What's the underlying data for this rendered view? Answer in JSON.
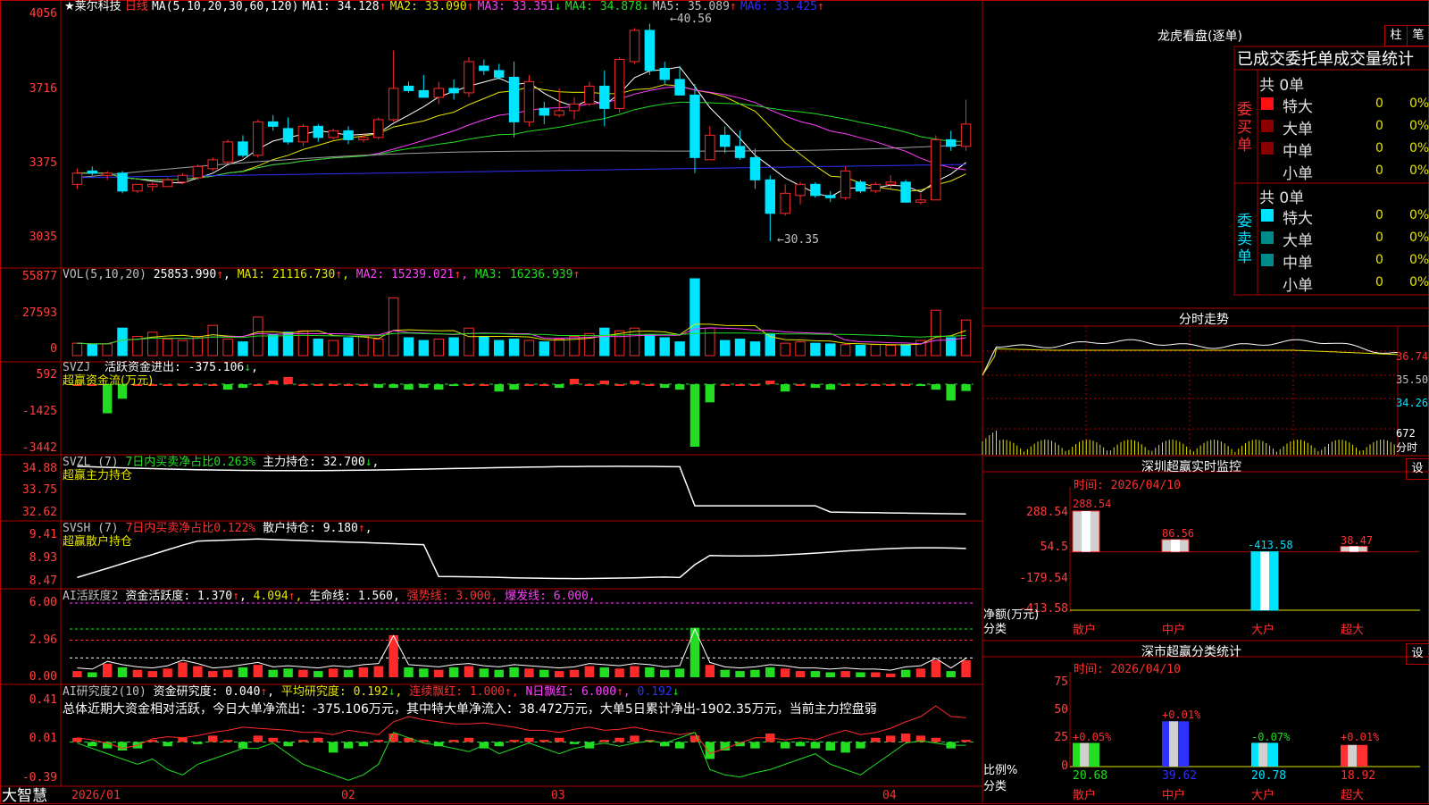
{
  "colors": {
    "up": "#ff2a2a",
    "down": "#00e5ff",
    "ma1": "#ffffff",
    "ma2": "#e6e600",
    "ma3": "#ff40ff",
    "ma4": "#22dd22",
    "ma5": "#a0a0a0",
    "ma6": "#3030ff",
    "frame": "#b00000"
  },
  "kline": {
    "name": "莱尔科技",
    "period": "日线",
    "ma_periods": "MA(5,10,20,30,60,120)",
    "ma1_label": "MA1:",
    "ma1_value": "34.128",
    "ma1_arrow": "↑",
    "ma2_label": "MA2:",
    "ma2_value": "33.090",
    "ma2_arrow": "↑",
    "ma3_label": "MA3:",
    "ma3_value": "33.351",
    "ma3_arrow": "↓",
    "ma4_label": "MA4:",
    "ma4_value": "34.878",
    "ma4_arrow": "↓",
    "ma5_label": "MA5:",
    "ma5_value": "35.089",
    "ma5_arrow": "↑",
    "ma6_label": "MA6:",
    "ma6_value": "33.425",
    "ma6_arrow": "↑",
    "y_ticks": [
      "4056",
      "3716",
      "3375",
      "3035"
    ],
    "high_marker": "40.56",
    "low_marker": "30.35",
    "candles": [
      [
        32.9,
        33.6,
        32.7,
        33.4
      ],
      [
        33.5,
        33.7,
        33.3,
        33.4
      ],
      [
        33.3,
        33.5,
        33.1,
        33.4
      ],
      [
        33.4,
        33.5,
        32.5,
        32.6
      ],
      [
        32.6,
        32.9,
        32.5,
        32.9
      ],
      [
        32.8,
        33.0,
        32.6,
        32.9
      ],
      [
        32.8,
        33.2,
        32.8,
        33.1
      ],
      [
        33.0,
        33.4,
        32.9,
        33.3
      ],
      [
        33.2,
        33.8,
        33.1,
        33.7
      ],
      [
        33.6,
        34.1,
        33.5,
        34.0
      ],
      [
        33.9,
        34.9,
        33.8,
        34.8
      ],
      [
        34.8,
        35.1,
        34.1,
        34.2
      ],
      [
        34.2,
        35.8,
        34.1,
        35.7
      ],
      [
        35.7,
        36.0,
        35.3,
        35.5
      ],
      [
        35.4,
        35.9,
        34.7,
        34.8
      ],
      [
        34.8,
        35.6,
        34.6,
        35.5
      ],
      [
        35.5,
        35.6,
        34.8,
        35.0
      ],
      [
        35.0,
        35.4,
        34.9,
        35.3
      ],
      [
        35.3,
        35.5,
        34.7,
        34.9
      ],
      [
        34.9,
        35.2,
        34.8,
        35.0
      ],
      [
        35.0,
        35.9,
        34.9,
        35.8
      ],
      [
        35.8,
        38.9,
        35.7,
        37.2
      ],
      [
        37.3,
        37.5,
        37.0,
        37.1
      ],
      [
        37.1,
        37.8,
        36.8,
        36.8
      ],
      [
        36.8,
        37.5,
        36.5,
        37.2
      ],
      [
        37.2,
        37.6,
        36.7,
        37.0
      ],
      [
        37.0,
        38.6,
        36.8,
        38.4
      ],
      [
        38.2,
        38.5,
        37.8,
        38.0
      ],
      [
        38.0,
        38.3,
        37.6,
        37.7
      ],
      [
        37.7,
        38.4,
        35.0,
        35.7
      ],
      [
        35.7,
        37.8,
        35.5,
        37.5
      ],
      [
        36.3,
        36.6,
        35.6,
        36.0
      ],
      [
        36.0,
        37.2,
        35.9,
        36.2
      ],
      [
        36.2,
        36.8,
        35.8,
        36.5
      ],
      [
        36.5,
        37.5,
        36.4,
        37.3
      ],
      [
        37.3,
        38.0,
        35.5,
        36.3
      ],
      [
        36.3,
        38.6,
        36.1,
        38.5
      ],
      [
        38.4,
        39.9,
        38.3,
        39.8
      ],
      [
        39.8,
        40.1,
        37.8,
        38.0
      ],
      [
        38.1,
        38.4,
        37.4,
        37.6
      ],
      [
        37.6,
        38.2,
        37.0,
        36.9
      ],
      [
        36.9,
        37.4,
        33.4,
        34.1
      ],
      [
        34.0,
        35.5,
        34.0,
        35.1
      ],
      [
        35.1,
        35.5,
        34.3,
        34.6
      ],
      [
        34.6,
        35.3,
        34.0,
        34.1
      ],
      [
        34.1,
        34.5,
        32.7,
        33.1
      ],
      [
        33.1,
        33.3,
        30.35,
        31.6
      ],
      [
        31.6,
        32.9,
        31.5,
        32.5
      ],
      [
        32.4,
        33.0,
        32.0,
        32.9
      ],
      [
        32.9,
        33.0,
        32.3,
        32.4
      ],
      [
        32.4,
        32.6,
        32.1,
        32.3
      ],
      [
        32.3,
        33.7,
        32.2,
        33.5
      ],
      [
        33.0,
        33.1,
        32.5,
        32.6
      ],
      [
        32.6,
        33.0,
        32.5,
        32.9
      ],
      [
        32.9,
        33.3,
        32.7,
        33.0
      ],
      [
        33.0,
        33.1,
        32.1,
        32.1
      ],
      [
        32.1,
        32.5,
        32.0,
        32.2
      ],
      [
        32.2,
        35.1,
        32.2,
        34.9
      ],
      [
        34.9,
        35.3,
        34.4,
        34.6
      ],
      [
        34.6,
        36.7,
        34.4,
        35.6
      ]
    ]
  },
  "volume": {
    "label": "VOL(5,10,20)",
    "value": "25853.990",
    "arrow": "↑",
    "ma1_label": "MA1:",
    "ma1_value": "21116.730",
    "ma1_arrow": "↑",
    "ma2_label": "MA2:",
    "ma2_value": "15239.021",
    "ma2_arrow": "↑",
    "ma3_label": "MA3:",
    "ma3_value": "16236.939",
    "ma3_arrow": "↑",
    "y_ticks": [
      "55877",
      "27593",
      "0"
    ],
    "values": [
      9000,
      8000,
      8500,
      20000,
      14000,
      17000,
      12000,
      11000,
      14000,
      22000,
      12000,
      10000,
      28000,
      15000,
      17000,
      18000,
      12000,
      11000,
      13000,
      14000,
      12000,
      42000,
      13000,
      11000,
      12000,
      13000,
      20000,
      14000,
      11000,
      12000,
      11000,
      10000,
      12000,
      14000,
      16000,
      20000,
      18000,
      20000,
      15000,
      13000,
      10000,
      55877,
      20000,
      11000,
      12000,
      10000,
      16000,
      9000,
      10000,
      9000,
      8500,
      8000,
      7500,
      8000,
      7500,
      8000,
      11000,
      33000,
      13000,
      25853
    ]
  },
  "svzj": {
    "label": "SVZJ",
    "name": "活跃资金进出:",
    "value": "-375.106",
    "arrow": "↓",
    "sub": "超赢资金流(万元)",
    "y_ticks": [
      "592",
      "-1425",
      "-3442"
    ],
    "values": [
      0,
      0,
      -1600,
      -800,
      0,
      0,
      0,
      0,
      0,
      0,
      -300,
      -200,
      0,
      200,
      400,
      0,
      0,
      0,
      0,
      0,
      -200,
      -200,
      -300,
      -200,
      -300,
      -100,
      0,
      0,
      -400,
      -300,
      0,
      0,
      -200,
      300,
      0,
      200,
      0,
      200,
      0,
      -200,
      -300,
      -3442,
      -1000,
      0,
      0,
      0,
      200,
      -400,
      0,
      -200,
      -300,
      0,
      0,
      0,
      0,
      0,
      -100,
      -300,
      -900,
      -375
    ]
  },
  "svzl": {
    "label": "SVZL (7)",
    "sub_label": "7日内买卖净占比",
    "sub_value": "0.263%",
    "name": "主力持仓:",
    "value": "32.700",
    "arrow": "↓",
    "sub": "超赢主力持仓",
    "y_ticks": [
      "34.88",
      "33.75",
      "32.62"
    ]
  },
  "svsh": {
    "label": "SVSH (7)",
    "sub_label": "7日内买卖净占比",
    "sub_value": "0.122%",
    "name": "散户持仓:",
    "value": "9.180",
    "arrow": "↑",
    "sub": "超赢散户持仓",
    "y_ticks": [
      "9.41",
      "8.93",
      "8.47"
    ]
  },
  "active": {
    "label": "AI活跃度2",
    "name": "资金活跃度:",
    "value": "1.370",
    "arrow": "↑",
    "value2": "4.094",
    "arrow2": "↑",
    "life_label": "生命线:",
    "life_value": "1.560",
    "strong_label": "强势线:",
    "strong_value": "3.000",
    "burst_label": "爆发线:",
    "burst_value": "6.000",
    "y_ticks": [
      "6.00",
      "2.96",
      "0.00"
    ]
  },
  "research": {
    "label": "AI研究度2(10)",
    "name": "资金研究度:",
    "value": "0.040",
    "arrow": "↑",
    "avg_label": "平均研究度:",
    "avg_value": "0.192",
    "avg_arrow": "↓",
    "cont_label": "连续飘红:",
    "cont_value": "1.000",
    "cont_arrow": "↑",
    "n_label": "N日飘红:",
    "n_value": "6.000",
    "n_arrow": "↑",
    "extra_value": "0.192",
    "extra_arrow": "↓",
    "summary": "总体近期大资金相对活跃，今日大单净流出：-375.106万元，其中特大单净流入：38.472万元，大单5日累计净出-1902.35万元，当前主力控盘弱",
    "y_ticks": [
      "0.41",
      "0.01",
      "-0.39"
    ]
  },
  "xaxis": {
    "brand": "大智慧",
    "labels": [
      "2026/01",
      "02",
      "03",
      "04"
    ]
  },
  "longhu": {
    "title": "龙虎看盘(逐单)",
    "tab_bar": "柱",
    "tab_trade": "笔",
    "subtitle": "已成交委托单成交量统计",
    "buy_label": "委买单",
    "sell_label": "委卖单",
    "buy_total": "共 0单",
    "sell_total": "共 0单",
    "rows": [
      "特大",
      "大单",
      "中单",
      "小单"
    ],
    "counts": [
      "0",
      "0",
      "0",
      "0"
    ],
    "pcts": [
      "0%",
      "0%",
      "0%",
      "0%"
    ],
    "buy_colors": [
      "#ff1010",
      "#8a0000",
      "#8a0000",
      "#000000"
    ],
    "sell_colors": [
      "#00e5ff",
      "#008b8b",
      "#008b8b",
      "#000000"
    ]
  },
  "intraday": {
    "title": "分时走势",
    "y_labels": [
      "36.74",
      "35.50",
      "34.26"
    ],
    "vol_label": "672",
    "vol_unit": "分时"
  },
  "monitor": {
    "title": "深圳超赢实时监控",
    "set": "设",
    "time": "时间: 2026/04/10",
    "y_ticks": [
      "288.54",
      "54.5",
      "-179.54",
      "-413.58"
    ],
    "unit": "净额(万元)",
    "cat_label": "分类",
    "categories": [
      "散户",
      "中户",
      "大户",
      "超大"
    ],
    "values": [
      288.54,
      86.56,
      -413.58,
      38.47
    ],
    "value_labels": [
      "288.54",
      "86.56",
      "-413.58",
      "38.47"
    ]
  },
  "classify": {
    "title": "深市超赢分类统计",
    "set": "设",
    "time": "时间: 2026/04/10",
    "y_ticks": [
      "75",
      "50",
      "25",
      "0"
    ],
    "unit": "比例%",
    "cat_label": "分类",
    "categories": [
      "散户",
      "中户",
      "大户",
      "超大"
    ],
    "values": [
      20.68,
      39.62,
      20.78,
      18.92
    ],
    "value_labels": [
      "20.68",
      "39.62",
      "20.78",
      "18.92"
    ],
    "delta_labels": [
      "+0.05%",
      "+0.01%",
      "-0.07%",
      "+0.01%"
    ]
  }
}
